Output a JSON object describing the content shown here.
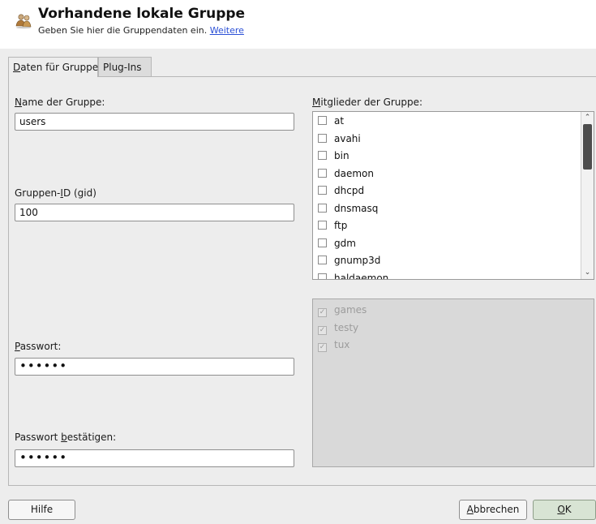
{
  "header": {
    "title": "Vorhandene lokale Gruppe",
    "subtitle": "Geben Sie hier die Gruppendaten ein.",
    "link": "Weitere",
    "icon": "group-icon"
  },
  "tabs": [
    {
      "label_first": "D",
      "label_rest": "aten für Gruppe",
      "active": true
    },
    {
      "label": "Plug-Ins",
      "active": false
    }
  ],
  "form": {
    "groupname": {
      "label_first": "N",
      "label_rest": "ame der Gruppe:",
      "value": "users"
    },
    "gid": {
      "label_pre": "Gruppen-",
      "label_ul": "I",
      "label_post": "D (gid)",
      "value": "100"
    },
    "password": {
      "label_first": "P",
      "label_rest": "asswort:",
      "value": "••••••"
    },
    "password_confirm": {
      "label_pre": "Passwort ",
      "label_ul": "b",
      "label_post": "estätigen:",
      "value": "••••••"
    }
  },
  "members": {
    "label_first": "M",
    "label_rest": "itglieder der Gruppe:",
    "items": [
      "at",
      "avahi",
      "bin",
      "daemon",
      "dhcpd",
      "dnsmasq",
      "ftp",
      "gdm",
      "gnump3d",
      "haldaemon"
    ],
    "scroll_position": 0.08
  },
  "default_members": {
    "items": [
      "games",
      "testy",
      "tux"
    ],
    "checked": true
  },
  "buttons": {
    "help": "Hilfe",
    "cancel_first": "A",
    "cancel_rest": "bbrechen",
    "ok_first": "O",
    "ok_rest": "K"
  },
  "colors": {
    "link": "#2a4fd6",
    "ok_button": "#d8e4d4",
    "background": "#ededed"
  }
}
